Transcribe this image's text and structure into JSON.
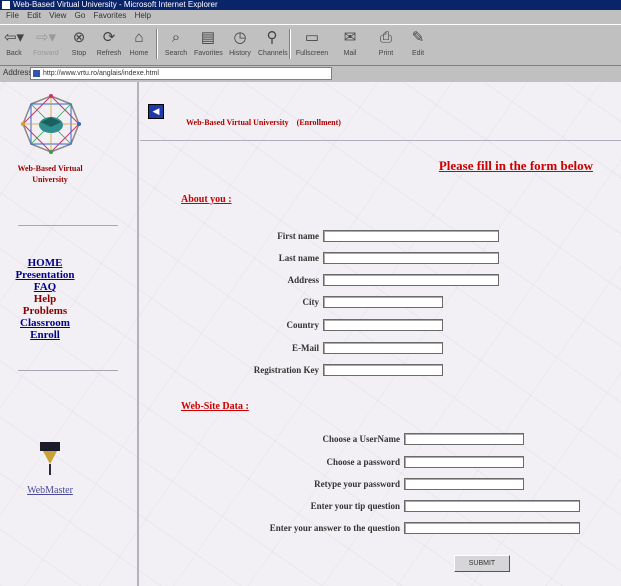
{
  "window": {
    "title": "Web-Based Virtual University - Microsoft Internet Explorer"
  },
  "menu": [
    "File",
    "Edit",
    "View",
    "Go",
    "Favorites",
    "Help"
  ],
  "toolbar": [
    {
      "label": "Back",
      "icon": "back-arrow-icon"
    },
    {
      "label": "Forward",
      "icon": "forward-arrow-icon"
    },
    {
      "label": "Stop",
      "icon": "stop-icon"
    },
    {
      "label": "Refresh",
      "icon": "refresh-icon"
    },
    {
      "label": "Home",
      "icon": "home-icon"
    },
    {
      "label": "Search",
      "icon": "search-icon"
    },
    {
      "label": "Favorites",
      "icon": "favorites-icon"
    },
    {
      "label": "History",
      "icon": "history-icon"
    },
    {
      "label": "Channels",
      "icon": "channels-icon"
    },
    {
      "label": "Fullscreen",
      "icon": "fullscreen-icon"
    },
    {
      "label": "Mail",
      "icon": "mail-icon"
    },
    {
      "label": "Print",
      "icon": "print-icon"
    },
    {
      "label": "Edit",
      "icon": "edit-icon"
    }
  ],
  "address": {
    "label": "Address",
    "url": "http://www.vrtu.ro/anglais/indexe.html"
  },
  "sidebar": {
    "university": "Web-Based Virtual University",
    "nav": [
      {
        "label": "HOME",
        "link": true
      },
      {
        "label": "Presentation",
        "link": true
      },
      {
        "label": "FAQ",
        "link": true
      },
      {
        "label": "Help",
        "link": false
      },
      {
        "label": "Problems",
        "link": false
      },
      {
        "label": "Classroom",
        "link": true
      },
      {
        "label": "Enroll",
        "link": true
      }
    ],
    "webmaster": "WebMaster"
  },
  "main": {
    "breadcrumb": "Web-Based Virtual University    (Enrollment)",
    "headline": "Please fill in the form below",
    "about_title": "About you :",
    "about_fields": [
      {
        "label": "First name",
        "value": ""
      },
      {
        "label": "Last name",
        "value": ""
      },
      {
        "label": "Address",
        "value": ""
      },
      {
        "label": "City",
        "value": ""
      },
      {
        "label": "Country",
        "value": ""
      },
      {
        "label": "E-Mail",
        "value": ""
      },
      {
        "label": "Registration Key",
        "value": ""
      }
    ],
    "site_title": "Web-Site Data :",
    "site_fields": [
      {
        "label": "Choose a UserName",
        "value": ""
      },
      {
        "label": "Choose a password",
        "value": ""
      },
      {
        "label": "Retype your password",
        "value": ""
      },
      {
        "label": "Enter your tip question",
        "value": ""
      },
      {
        "label": "Enter your answer to the question",
        "value": ""
      }
    ],
    "submit": "SUBMIT"
  },
  "colors": {
    "heading_red": "#cc0000",
    "link_blue": "#00008b",
    "titlebar": "#0a246a"
  }
}
